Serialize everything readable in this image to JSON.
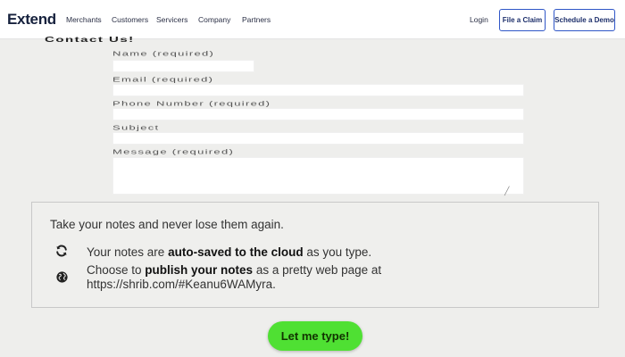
{
  "nav": {
    "logo": "Extend",
    "links": [
      "Merchants",
      "Customers",
      "Servicers",
      "Company",
      "Partners"
    ],
    "login": "Login",
    "file_claim": "File a Claim",
    "schedule_demo": "Schedule a Demo"
  },
  "form": {
    "heading": "Contact Us!",
    "name_label": "Name (required)",
    "email_label": "Email (required)",
    "phone_label": "Phone Number (required)",
    "subject_label": "Subject",
    "message_label": "Message (required)"
  },
  "promo": {
    "intro": "Take your notes and never lose them again.",
    "feature1_prefix": "Your notes are ",
    "feature1_bold": "auto-saved to the cloud",
    "feature1_suffix": " as you type.",
    "feature2_prefix": "Choose to ",
    "feature2_bold": "publish your notes",
    "feature2_suffix": " as a pretty web page at",
    "feature2_url": "https://shrib.com/#Keanu6WAMyra.",
    "cta_label": "Let me type!"
  },
  "icons": {
    "sync": "sync-icon",
    "globe": "globe-icon"
  },
  "colors": {
    "brand_navy": "#16213d",
    "outline_blue": "#2f56c7",
    "cta_green": "#4fe033"
  }
}
